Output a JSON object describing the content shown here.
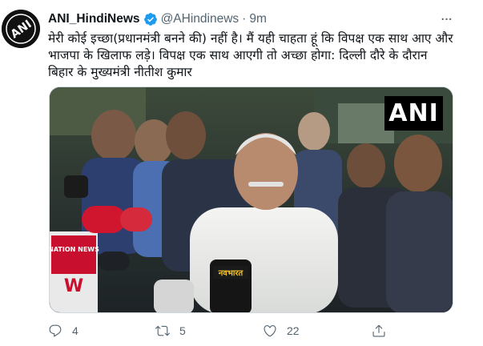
{
  "tweet": {
    "author_name": "ANI_HindiNews",
    "handle": "@AHindinews",
    "separator": "·",
    "time": "9m",
    "more_label": "···",
    "text_lines": [
      "मेरी कोई इच्छा(प्रधानमंत्री बनने की) नहीं है। मैं यही चाहता हूं कि विपक्ष एक साथ आए और",
      "भाजपा के खिलाफ लड़े। विपक्ष एक साथ आएगी तो अच्छा होगा: दिल्ली दौरे के दौरान",
      "बिहार के मुख्यमंत्री नीतीश कुमार"
    ],
    "avatar_text": "ANI",
    "media_watermark": "ANI",
    "mic_labels": [
      "NATION NEWS",
      "नवभारत"
    ],
    "actions": {
      "reply_count": "4",
      "retweet_count": "5",
      "like_count": "22",
      "share_count": ""
    }
  },
  "colors": {
    "text_primary": "#0f1419",
    "text_secondary": "#536471",
    "verified_blue": "#1d9bf0"
  }
}
